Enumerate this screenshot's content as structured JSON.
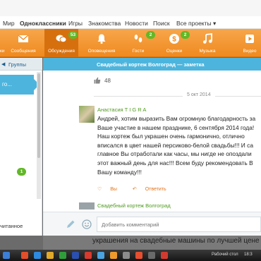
{
  "nav": {
    "items": [
      "Мир",
      "Одноклассники",
      "Игры",
      "Знакомства",
      "Новости",
      "Поиск",
      "Все проекты ▾"
    ],
    "active_index": 1
  },
  "toolbar": {
    "tools": [
      {
        "label": "Сообщения",
        "icon": "envelope-icon"
      },
      {
        "label": "Обсуждения",
        "icon": "discussions-icon",
        "badge": "53",
        "selected": true
      },
      {
        "label": "Оповещения",
        "icon": "bell-icon"
      },
      {
        "label": "Гости",
        "icon": "footprints-icon",
        "badge": "2"
      },
      {
        "label": "Оценки",
        "icon": "ratings-icon",
        "badge": "2"
      },
      {
        "label": "Музыка",
        "icon": "music-note-icon"
      },
      {
        "label": "Видео",
        "icon": "video-icon"
      }
    ],
    "first_label": "ки"
  },
  "left": {
    "tab": "Группы",
    "selected": "го...",
    "badge": "1",
    "footer": "читанное"
  },
  "chat": {
    "header": "Свадебный кортеж Волгоград — заметка",
    "likes": "48",
    "date": "5 окт 2014",
    "message": {
      "author": "Анастасия T I G R A",
      "lines": [
        "Андрей, хотим выразить Вам огромную благодарность за",
        "Ваше участие в нашем празднике, 6 сентября 2014 года!",
        "Наш кортеж был украшен очень гармонично, отлично",
        "вписался в цвет нашей персиково-белой свадьбы!!! И са",
        "главное Вы отработали как часы, мы нигде не опоздали",
        "этот важный день для нас!!! Всем буду рекомендовать В",
        "Вашу команду!!!"
      ],
      "action_like": "Вы",
      "action_reply": "Ответить"
    },
    "second_author": "Свадебный кортеж Волгоград",
    "compose_placeholder": "Добавить комментарий"
  },
  "ad_text": "украшения на свадебные машины по лучшей цене в В",
  "taskbar": {
    "desktop_label": "Рабочий стол",
    "clock": "18:3"
  },
  "colors": {
    "accent_orange": "#ef8a1f",
    "accent_blue": "#4db5dd",
    "badge_green": "#62b827",
    "author_green": "#4f9a1f"
  }
}
